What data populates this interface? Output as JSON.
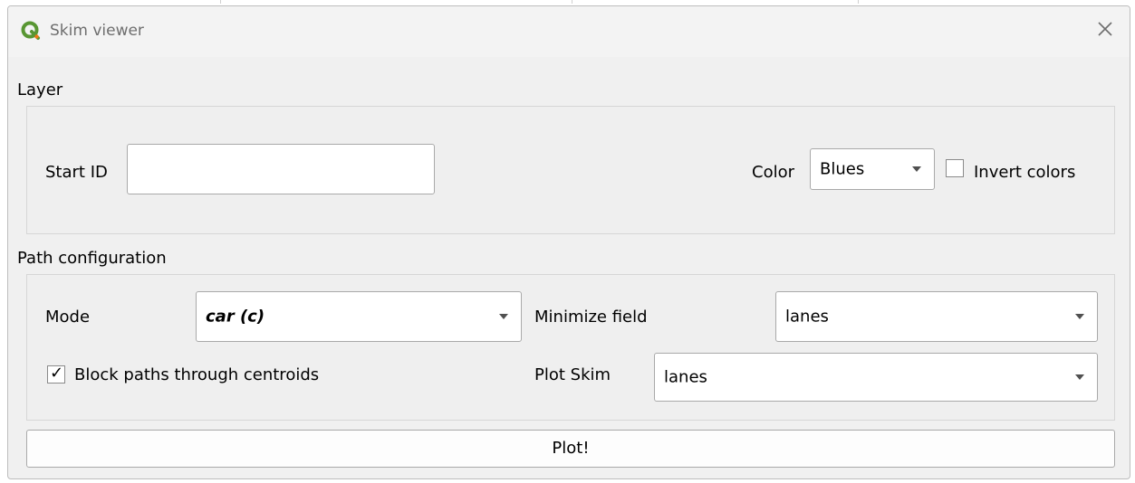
{
  "window": {
    "title": "Skim viewer",
    "icons": {
      "app": "qgis-logo-icon",
      "close": "close-icon"
    }
  },
  "layer": {
    "section_label": "Layer",
    "start_id_label": "Start ID",
    "start_id_value": "",
    "color_label": "Color",
    "color_value": "Blues",
    "invert_label": "Invert colors",
    "invert_checked": false
  },
  "path_configuration": {
    "section_label": "Path configuration",
    "mode_label": "Mode",
    "mode_value": "car (c)",
    "minimize_label": "Minimize field",
    "minimize_value": "lanes",
    "block_label": "Block paths through centroids",
    "block_checked": true,
    "plot_skim_label": "Plot Skim",
    "plot_skim_value": "lanes"
  },
  "actions": {
    "plot_label": "Plot!"
  },
  "colors": {
    "qgis_green": "#589632",
    "qgis_yellow": "#ee7913"
  }
}
